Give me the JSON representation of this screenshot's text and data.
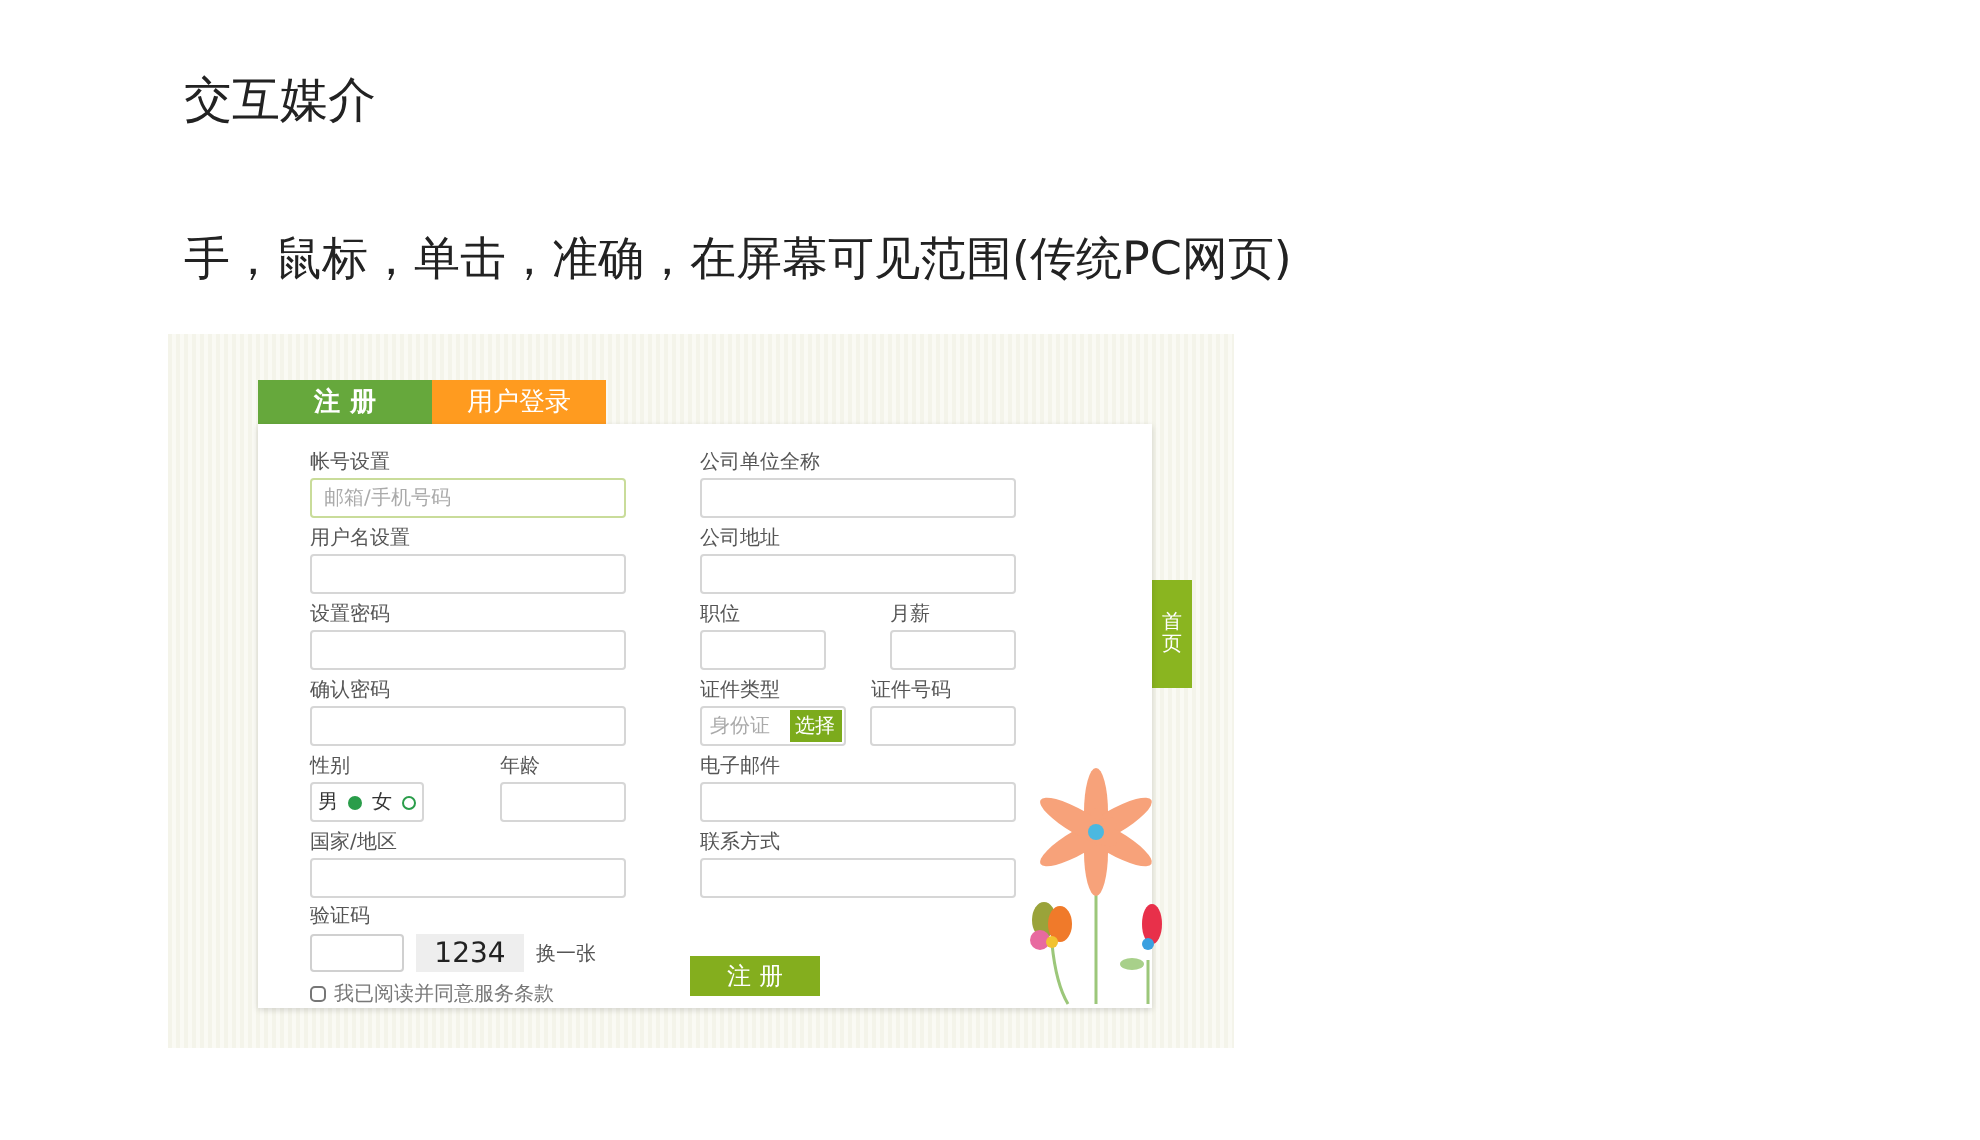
{
  "slide": {
    "title": "交互媒介",
    "subtitle": "手，鼠标，单击，准确，在屏幕可见范围(传统PC网页)"
  },
  "form": {
    "tabs": [
      {
        "label": "注 册",
        "selected": true
      },
      {
        "label": "用户登录",
        "selected": false
      }
    ],
    "left_rows": [
      [
        {
          "kind": "text",
          "label": "帐号设置",
          "placeholder": "邮箱/手机号码",
          "focused": true
        }
      ],
      [
        {
          "kind": "text",
          "label": "用户名设置",
          "focused": false
        }
      ],
      [
        {
          "kind": "text",
          "label": "设置密码",
          "focused": false
        }
      ],
      [
        {
          "kind": "text",
          "label": "确认密码",
          "focused": false
        }
      ],
      [
        {
          "kind": "gender",
          "label": "性别",
          "options": [
            {
              "label": "男",
              "selected": true
            },
            {
              "label": "女",
              "selected": false
            }
          ]
        },
        {
          "kind": "text",
          "label": "年龄",
          "focused": false
        }
      ],
      [
        {
          "kind": "text",
          "label": "国家/地区",
          "focused": false
        }
      ]
    ],
    "right_rows": [
      [
        {
          "kind": "text",
          "label": "公司单位全称",
          "focused": false
        }
      ],
      [
        {
          "kind": "text",
          "label": "公司地址",
          "focused": false
        }
      ],
      [
        {
          "kind": "text",
          "label": "职位",
          "focused": false
        },
        {
          "kind": "text",
          "label": "月薪",
          "focused": false
        }
      ],
      [
        {
          "kind": "select",
          "label": "证件类型",
          "value": "身份证",
          "button": "选择"
        },
        {
          "kind": "text",
          "label": "证件号码",
          "focused": false
        }
      ],
      [
        {
          "kind": "text",
          "label": "电子邮件",
          "focused": false
        }
      ],
      [
        {
          "kind": "text",
          "label": "联系方式",
          "focused": false
        }
      ]
    ],
    "captcha": {
      "label": "验证码",
      "code": "1234",
      "refresh": "换一张"
    },
    "agreement": {
      "text": "我已阅读并同意服务条款",
      "checked": false
    },
    "submit": "注 册",
    "side_tab": "首页"
  }
}
